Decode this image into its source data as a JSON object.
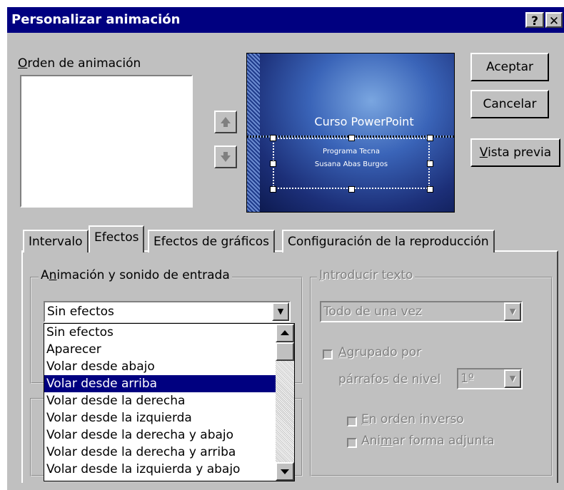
{
  "window": {
    "title": "Personalizar animación",
    "help_label": "?",
    "close_label": "✕"
  },
  "order": {
    "label_accel": "O",
    "label_rest": "rden de animación"
  },
  "preview": {
    "slide_title": "Curso PowerPoint",
    "line1": "Programa Tecna",
    "line2": "Susana Abas Burgos"
  },
  "buttons": {
    "accept": "Aceptar",
    "cancel": "Cancelar",
    "preview_accel": "V",
    "preview_rest": "ista previa"
  },
  "tabs": [
    {
      "label": "Intervalo"
    },
    {
      "label": "Efectos"
    },
    {
      "label": "Efectos de gráficos"
    },
    {
      "label": "Configuración de la reproducción"
    }
  ],
  "entry_group": {
    "label_pre": "A",
    "label_accel": "n",
    "label_rest": "imación y sonido de entrada",
    "combo_value": "Sin efectos",
    "options": [
      "Sin efectos",
      "Aparecer",
      "Volar desde abajo",
      "Volar desde arriba",
      "Volar desde la derecha",
      "Volar desde la izquierda",
      "Volar desde la derecha y abajo",
      "Volar desde la derecha y arriba",
      "Volar desde la izquierda y abajo"
    ],
    "selected_index": 3
  },
  "text_group": {
    "label_accel": "I",
    "label_rest": "ntroducir texto",
    "combo_value": "Todo de una vez",
    "grouped_accel": "A",
    "grouped_rest": "grupado por",
    "level_label": "párrafos de nivel",
    "level_value": "1º",
    "reverse_accel": "E",
    "reverse_rest": "n orden inverso",
    "animate_pre": "Ani",
    "animate_accel": "m",
    "animate_rest": "ar forma adjunta"
  }
}
